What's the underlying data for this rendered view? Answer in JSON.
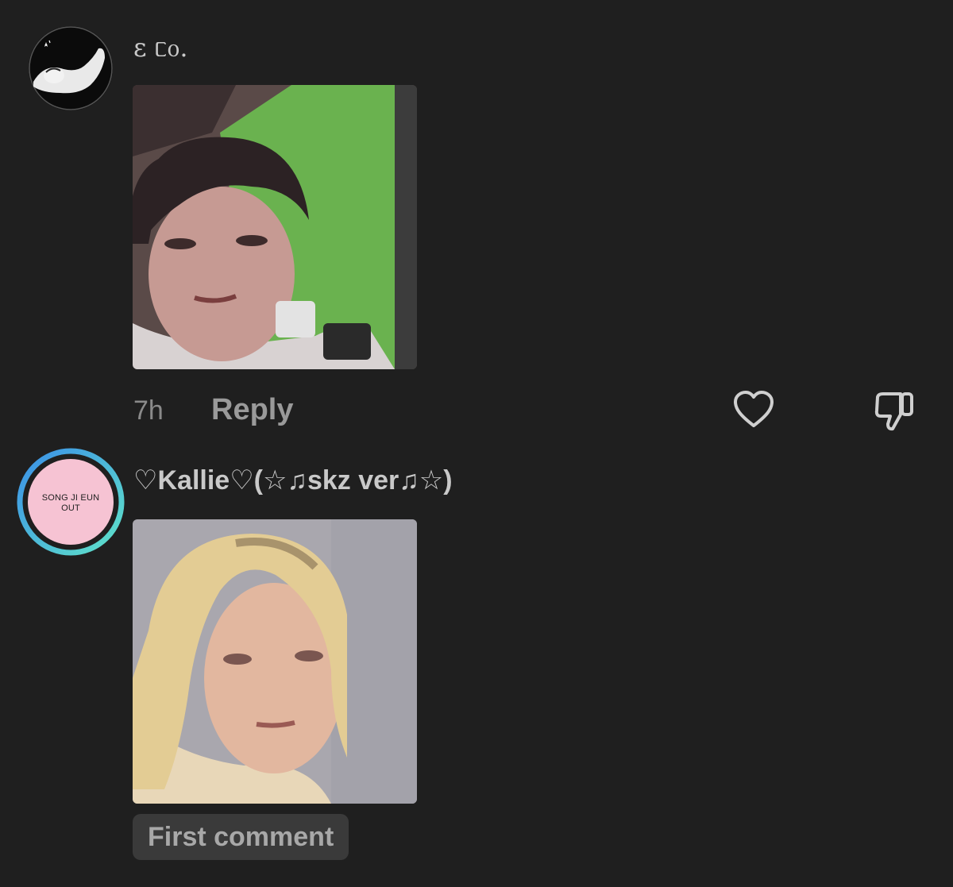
{
  "comments": [
    {
      "username": "ɛ ᥴ᧐.",
      "avatar_icon": "sleeping-figure-avatar",
      "media_icon": "face-photo-green-background",
      "time": "7h",
      "reply_label": "Reply",
      "like_icon": "heart-outline-icon",
      "dislike_icon": "thumbs-down-outline-icon"
    },
    {
      "username": "♡Kallie♡(☆♫skz ver♫☆)",
      "avatar_text_line1": "SONG JI EUN",
      "avatar_text_line2": "OUT",
      "avatar_ring_colors": [
        "#3b8fe8",
        "#5fe3c9"
      ],
      "media_icon": "blonde-face-photo",
      "badge_label": "First comment"
    }
  ],
  "colors": {
    "background": "#1f1f1f",
    "text": "#c9c9c9",
    "muted": "#8a8a8a",
    "badge_bg": "#3a3a3a",
    "avatar_pink": "#f6c3d3"
  }
}
